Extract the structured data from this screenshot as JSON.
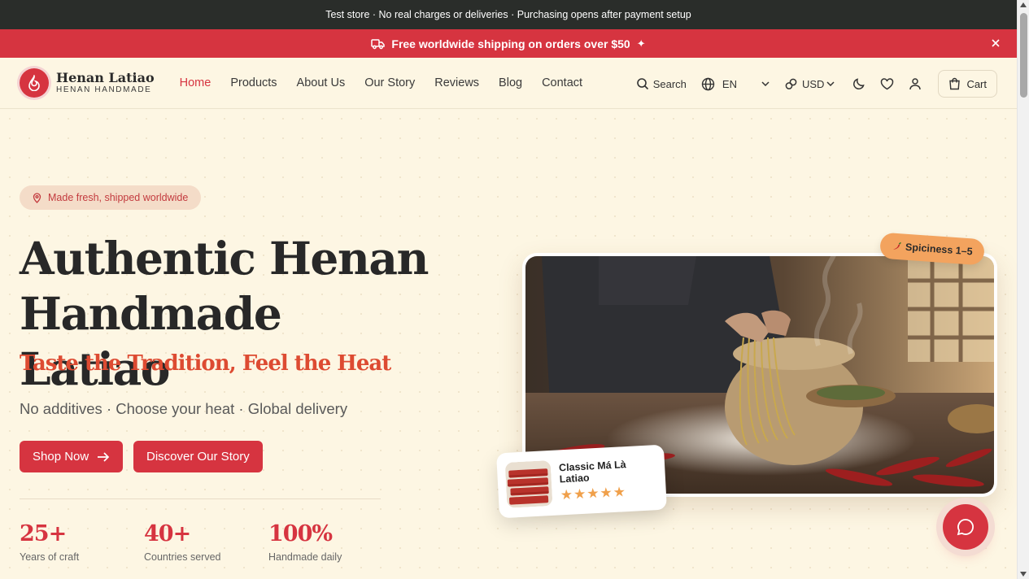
{
  "test_bar": {
    "text": "Test store · No real charges or deliveries · Purchasing opens after payment setup"
  },
  "promo": {
    "text": "Free worldwide shipping on orders over $50",
    "sparkle": "✦"
  },
  "brand": {
    "name": "Henan Latiao",
    "tagline": "HENAN HANDMADE"
  },
  "nav": {
    "items": [
      {
        "label": "Home",
        "active": true
      },
      {
        "label": "Products"
      },
      {
        "label": "About Us"
      },
      {
        "label": "Our Story"
      },
      {
        "label": "Reviews"
      },
      {
        "label": "Blog"
      },
      {
        "label": "Contact"
      }
    ]
  },
  "tools": {
    "search": "Search",
    "language": "EN",
    "currency": "USD",
    "cart": "Cart"
  },
  "hero": {
    "pill": "Made fresh, shipped worldwide",
    "title": "Authentic Henan Handmade Latiao",
    "tagline": "Taste the Tradition, Feel the Heat",
    "subtitle": "No additives · Choose your heat · Global delivery",
    "shop_btn": "Shop Now",
    "story_btn": "Discover Our Story",
    "stats": [
      {
        "num": "25+",
        "label": "Years of craft"
      },
      {
        "num": "40+",
        "label": "Countries served"
      },
      {
        "num": "100%",
        "label": "Handmade daily"
      }
    ],
    "spice_badge": "Spiciness 1–5",
    "product": {
      "name": "Classic Má Là Latiao",
      "stars": "★★★★★",
      "rating": 5
    }
  },
  "colors": {
    "brand_red": "#d63440",
    "cream": "#fdf6e3",
    "tagline_orange": "#dd4b32",
    "badge_orange": "#f3a35e",
    "dark_bar": "#2a2d2a"
  }
}
